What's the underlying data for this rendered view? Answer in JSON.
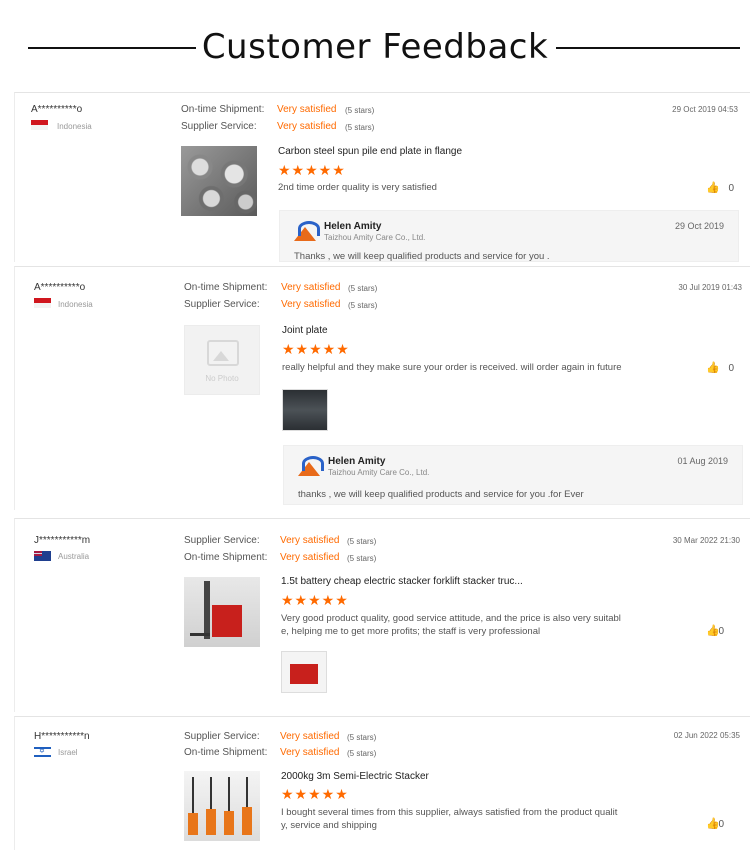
{
  "header": {
    "title": "Customer Feedback"
  },
  "colors": {
    "accent": "#ff6a00"
  },
  "reviews": [
    {
      "buyer": "A**********o",
      "country": "Indonesia",
      "ratings": [
        {
          "label": "On-time Shipment:",
          "value": "Very satisfied",
          "stars": "(5 stars)"
        },
        {
          "label": "Supplier Service:",
          "value": "Very satisfied",
          "stars": "(5 stars)"
        }
      ],
      "date": "29 Oct 2019 04:53",
      "product": "Carbon steel spun pile end plate in flange",
      "star_glyphs": "★★★★★",
      "rating": 5,
      "comment": "2nd time order quality is very satisfied",
      "likes": "0",
      "reply": {
        "name": "Helen Amity",
        "company": "Taizhou Amity Care Co., Ltd.",
        "date": "29 Oct 2019",
        "text": "Thanks , we will  keep qualified products and service for you ."
      }
    },
    {
      "buyer": "A**********o",
      "country": "Indonesia",
      "ratings": [
        {
          "label": "On-time Shipment:",
          "value": "Very satisfied",
          "stars": "(5 stars)"
        },
        {
          "label": "Supplier Service:",
          "value": "Very satisfied",
          "stars": "(5 stars)"
        }
      ],
      "date": "30 Jul 2019 01:43",
      "product": "Joint plate",
      "no_photo": "No Photo",
      "star_glyphs": "★★★★★",
      "rating": 5,
      "comment": "really helpful and they make sure your order is received. will order again in future",
      "likes": "0",
      "reply": {
        "name": "Helen Amity",
        "company": "Taizhou Amity Care Co., Ltd.",
        "date": "01 Aug 2019",
        "text": "thanks , we will  keep qualified products and service for you .for Ever"
      }
    },
    {
      "buyer": "J***********m",
      "country": "Australia",
      "ratings": [
        {
          "label": "Supplier Service:",
          "value": "Very satisfied",
          "stars": "(5 stars)"
        },
        {
          "label": "On-time Shipment:",
          "value": "Very satisfied",
          "stars": "(5 stars)"
        }
      ],
      "date": "30 Mar 2022 21:30",
      "product": "1.5t battery cheap electric stacker forklift stacker truc...",
      "star_glyphs": "★★★★★",
      "rating": 5,
      "comment_line1": "Very good product quality, good service attitude, and the price is also very suitabl",
      "comment_line2": "e, helping me to get more profits; the staff is very professional",
      "likes": "0"
    },
    {
      "buyer": "H***********n",
      "country": "Israel",
      "ratings": [
        {
          "label": "Supplier Service:",
          "value": "Very satisfied",
          "stars": "(5 stars)"
        },
        {
          "label": "On-time Shipment:",
          "value": "Very satisfied",
          "stars": "(5 stars)"
        }
      ],
      "date": "02 Jun 2022 05:35",
      "product": "2000kg 3m Semi-Electric Stacker",
      "star_glyphs": "★★★★★",
      "rating": 5,
      "comment_line1": "I bought several times from this supplier, always satisfied from the product qualit",
      "comment_line2": "y, service and shipping",
      "likes": "0"
    }
  ]
}
